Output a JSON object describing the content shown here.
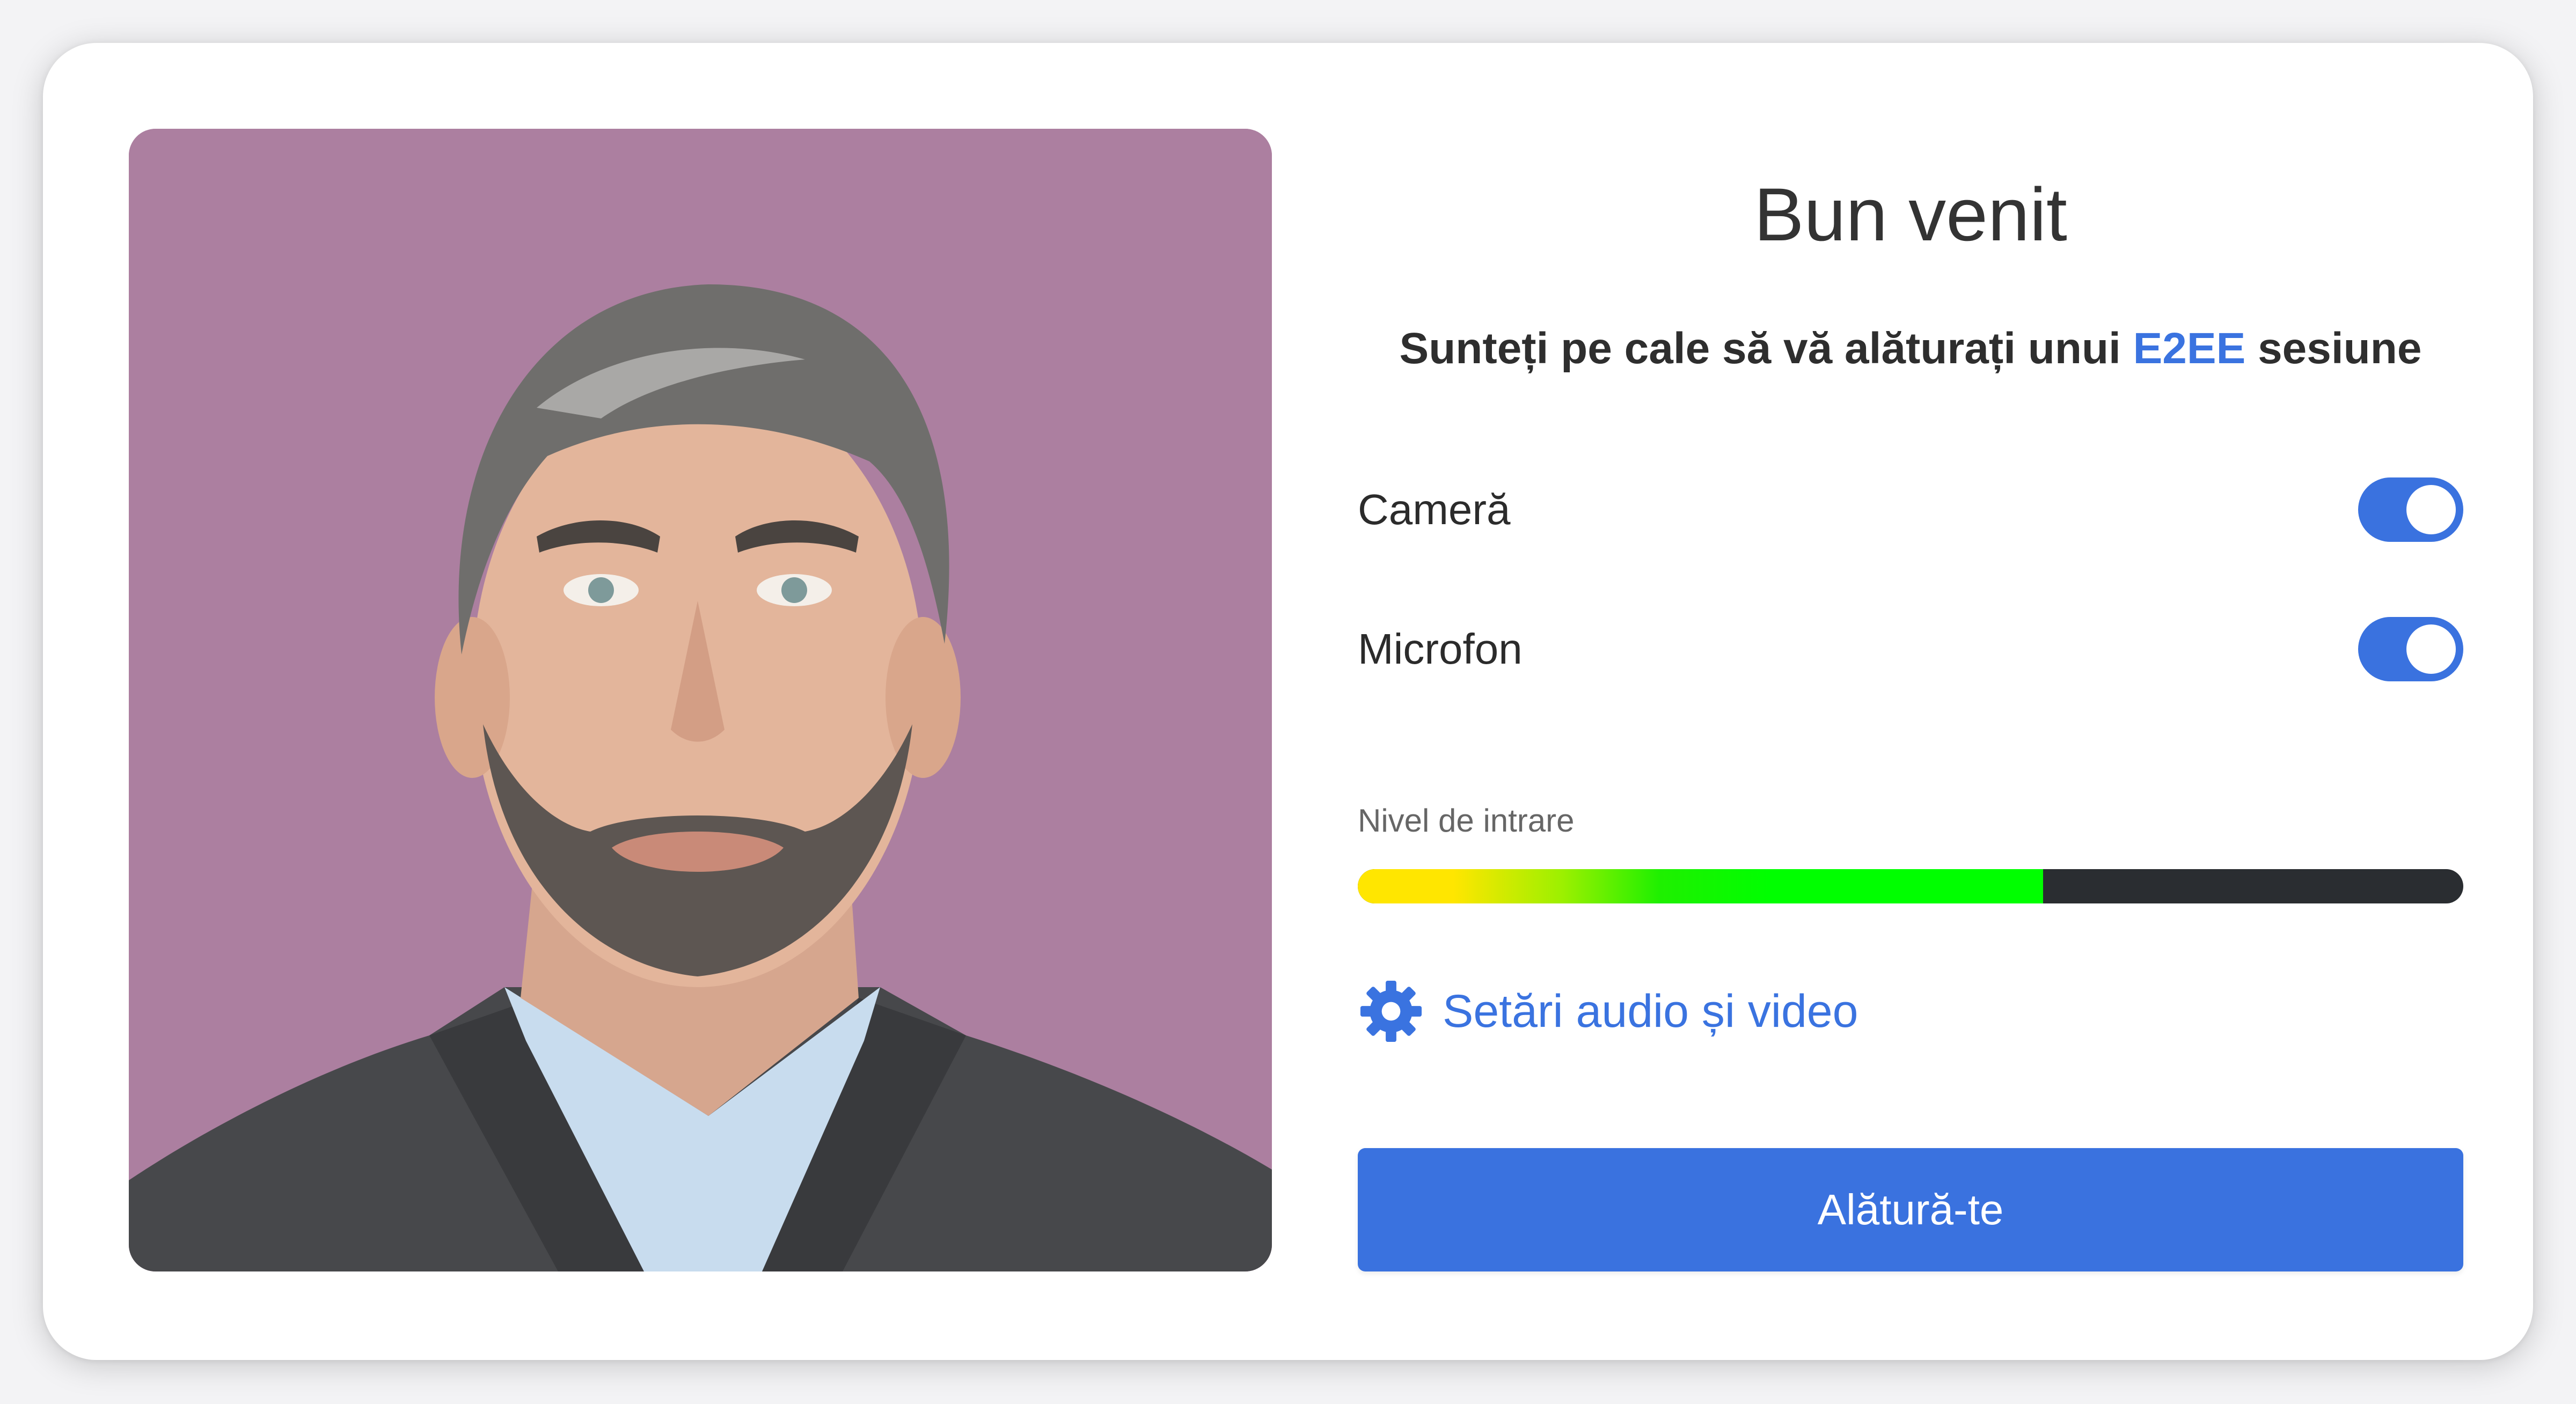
{
  "header": {
    "title": "Bun venit",
    "subtitle_before": "Sunteți pe cale să vă alăturați unui ",
    "subtitle_highlight": "E2EE",
    "subtitle_after": " sesiune"
  },
  "controls": {
    "camera": {
      "label": "Cameră",
      "enabled": true
    },
    "microphone": {
      "label": "Microfon",
      "enabled": true
    }
  },
  "input_level": {
    "label": "Nivel de intrare",
    "level_fraction": 0.62
  },
  "settings_link": {
    "label": "Setări audio și video",
    "icon": "gear-icon"
  },
  "join_button": {
    "label": "Alătură-te"
  },
  "colors": {
    "accent": "#3a72df",
    "link": "#3a73e0",
    "preview_background": "#ac7fa0",
    "meter_track": "#2a2d31",
    "meter_low": "#ffe600",
    "meter_high": "#00ff00"
  }
}
